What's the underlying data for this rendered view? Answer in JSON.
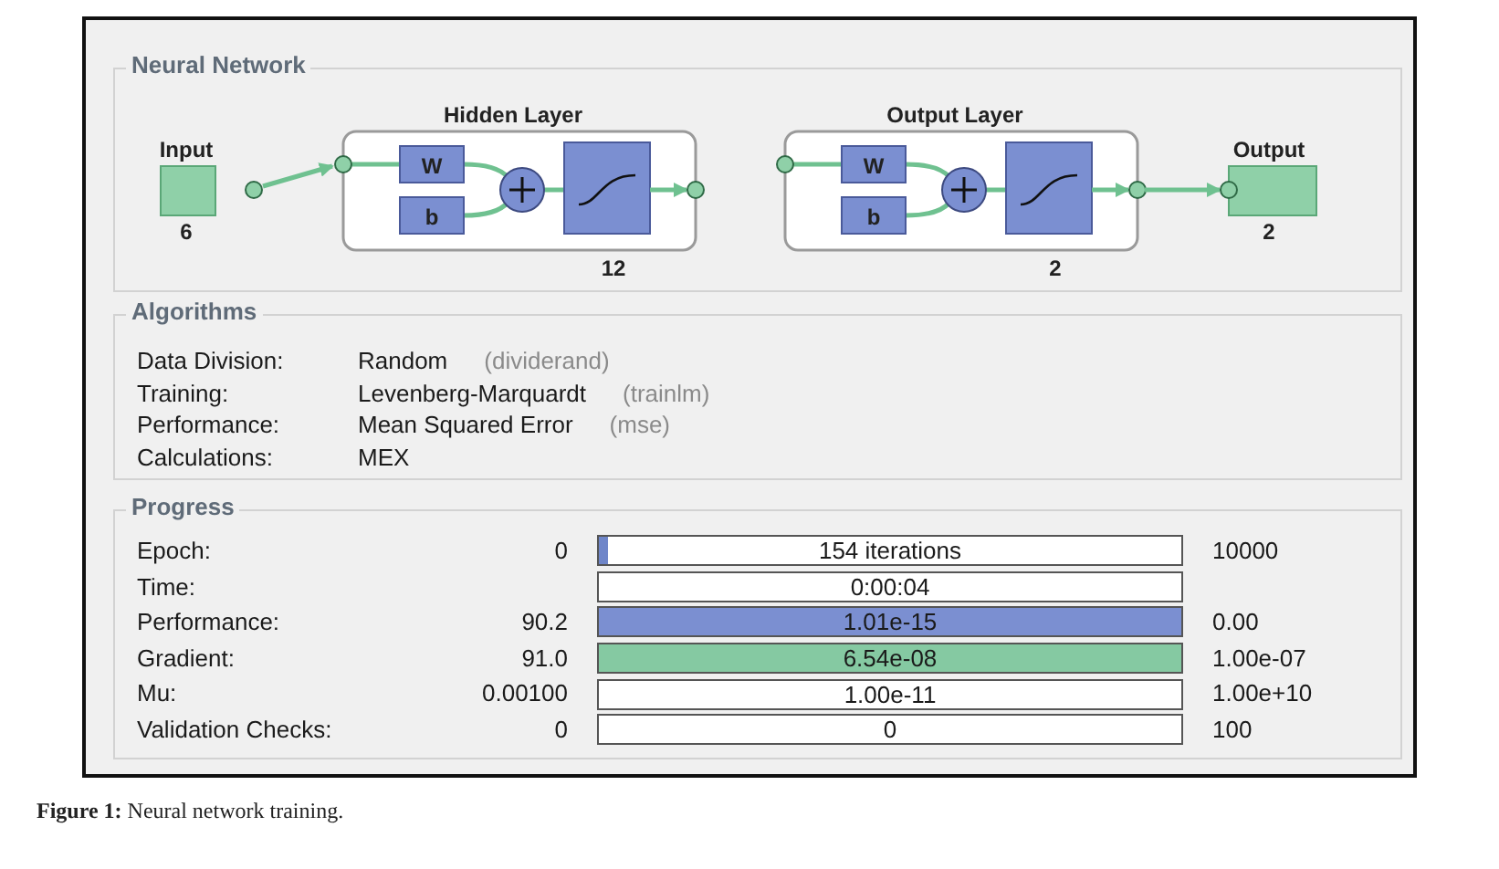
{
  "network": {
    "title": "Neural Network",
    "input": {
      "label": "Input",
      "size": "6"
    },
    "layers": [
      {
        "title": "Hidden Layer",
        "weight": "W",
        "bias": "b",
        "size": "12"
      },
      {
        "title": "Output Layer",
        "weight": "W",
        "bias": "b",
        "size": "2"
      }
    ],
    "output": {
      "label": "Output",
      "size": "2"
    }
  },
  "algorithms": {
    "title": "Algorithms",
    "rows": [
      {
        "label": "Data Division:",
        "value": "Random",
        "note": "(dividerand)"
      },
      {
        "label": "Training:",
        "value": "Levenberg-Marquardt",
        "note": "(trainlm)"
      },
      {
        "label": "Performance:",
        "value": "Mean Squared Error",
        "note": "(mse)"
      },
      {
        "label": "Calculations:",
        "value": "MEX"
      }
    ]
  },
  "progress": {
    "title": "Progress",
    "rows": [
      {
        "label": "Epoch:",
        "start": "0",
        "bar": "154 iterations",
        "end": "10000",
        "level": 0.015,
        "color": "#6f86c9"
      },
      {
        "label": "Time:",
        "bar": "0:00:04"
      },
      {
        "label": "Performance:",
        "start": "90.2",
        "bar": "1.01e-15",
        "end": "0.00",
        "level": 1,
        "color": "#7b8fd1"
      },
      {
        "label": "Gradient:",
        "start": "91.0",
        "bar": "6.54e-08",
        "end": "1.00e-07",
        "level": 1,
        "color": "#85c9a2"
      },
      {
        "label": "Mu:",
        "start": "0.00100",
        "bar": "1.00e-11",
        "end": "1.00e+10"
      },
      {
        "label": "Validation Checks:",
        "start": "0",
        "bar": "0",
        "end": "100"
      }
    ]
  },
  "caption": "**Figure 1:** Neural network training."
}
